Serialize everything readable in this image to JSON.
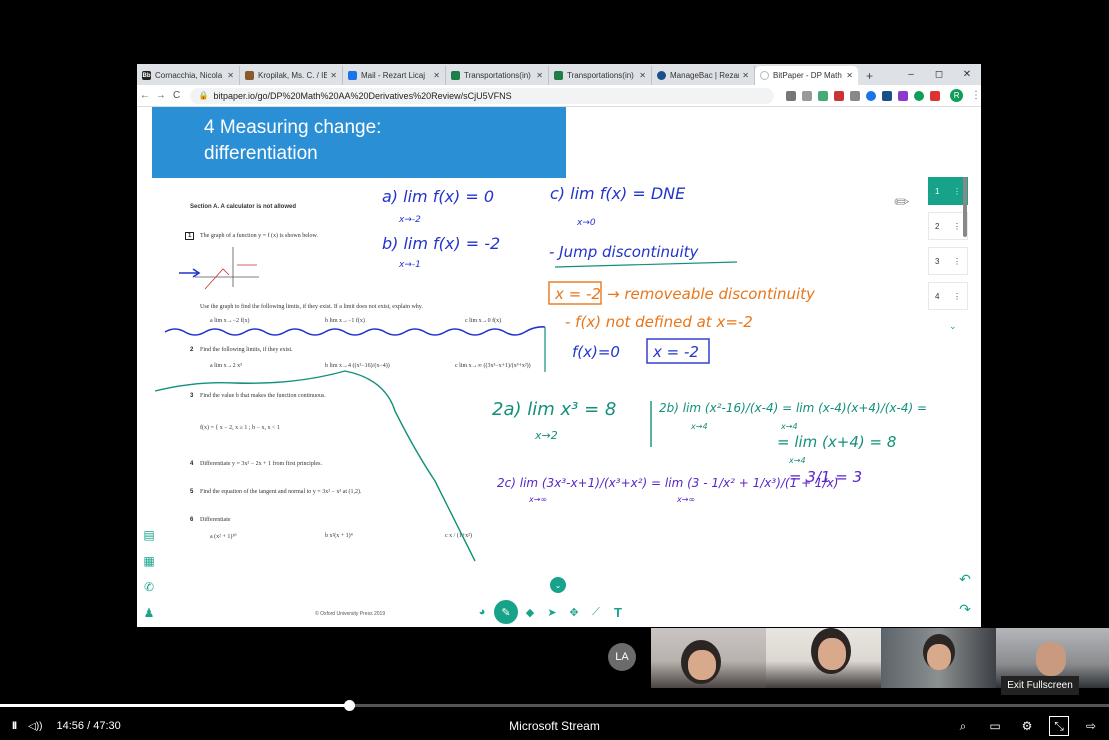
{
  "browser": {
    "tabs": [
      {
        "favicon": "Bb",
        "favicon_color": "#222",
        "label": "Cornacchia, Nicola"
      },
      {
        "favicon": "",
        "favicon_color": "#8a5a2b",
        "label": "Kropilak, Ms. C. / IB"
      },
      {
        "favicon": "",
        "favicon_color": "#1a73e8",
        "label": "Mail - Rezart Licaj"
      },
      {
        "favicon": "",
        "favicon_color": "#1e7e45",
        "label": "Transportations(in)"
      },
      {
        "favicon": "",
        "favicon_color": "#1e7e45",
        "label": "Transportations(in)"
      },
      {
        "favicon": "",
        "favicon_color": "#1a4f8a",
        "label": "ManageBac | Rezart"
      },
      {
        "favicon": "",
        "favicon_color": "#bbbbbb",
        "label": "BitPaper - DP Math"
      }
    ],
    "new_tab": "+",
    "window_controls": [
      "–",
      "◻",
      "✕"
    ],
    "url": "bitpaper.io/go/DP%20Math%20AA%20Derivatives%20Review/sCjU5VFNS",
    "profile_initial": "R"
  },
  "document": {
    "banner_title_line1": "4 Measuring change:",
    "banner_title_line2": "differentiation",
    "section_heading": "Section A. A calculator is not allowed",
    "q1": "The graph of a function y = f (x) is shown below.",
    "q1_instruction": "Use the graph to find the following limits, if they exist. If a limit does not exist, explain why.",
    "q1_a": "a  lim x→−2 f(x)",
    "q1_b": "b  lim x→−1 f(x)",
    "q1_c": "c  lim x→0 f(x)",
    "q2": "Find the following limits, if they exist.",
    "q2_a": "a  lim x→2 x³",
    "q2_b": "b  lim x→4 ((x²−16)/(x−4))",
    "q2_c": "c  lim x→∞ ((3x³−x+1)/(x³+x²))",
    "q3": "Find the value b that makes the function continuous.",
    "q3_f": "f(x) = { x − 2,  x ≥ 1 ;  b − x,  x < 1",
    "q4": "Differentiate y = 3x² − 2x + 1 from first principles.",
    "q5": "Find the equation of the tangent and normal to y = 3x² − x³ at (1,2).",
    "q6": "Differentiate",
    "q6_a": "a  (x² + 1)¹⁰",
    "q6_b": "b  x²(x + 1)⁴",
    "q6_c": "c  x / (1+x²)",
    "qnums": [
      "1",
      "2",
      "3",
      "4",
      "5",
      "6"
    ],
    "footer": "© Oxford University Press 2019",
    "page_badge": "1"
  },
  "handwriting": {
    "a_line1": "a) lim f(x) = 0",
    "a_line2": "x→-2",
    "b_line1": "b) lim f(x) = -2",
    "b_line2": "x→-1",
    "c_line1": "c) lim f(x) = DNE",
    "c_line2": "x→0",
    "jump": "- Jump discontinuity",
    "removable_box": "x = -2",
    "removable_text": "→ removeable discontinuity",
    "not_defined": "- f(x) not defined at x=-2",
    "fx0": "f(x)=0",
    "fx0_box": "x = -2",
    "two_a_1": "2a) lim x³ = 8",
    "two_a_2": "x→2",
    "two_b_1": "2b) lim (x²-16)/(x-4) = lim (x-4)(x+4)/(x-4) =",
    "two_b_2": "x→4",
    "two_b_3": "x→4",
    "two_b_4": "= lim (x+4) = 8",
    "two_b_5": "x→4",
    "two_c_1": "2c) lim (3x³-x+1)/(x³+x²) = lim (3 - 1/x² + 1/x³)/(1 + 1/x)",
    "two_c_2": "x→∞",
    "two_c_3": "x→∞",
    "two_c_4": "= 3/1 = 3",
    "colors": {
      "blue": "#2233cc",
      "teal": "#12907a",
      "orange": "#e8761a",
      "purple": "#5a24c8"
    }
  },
  "pages_panel": [
    {
      "label": "1",
      "menu": "⋮"
    },
    {
      "label": "2",
      "menu": "⋮"
    },
    {
      "label": "3",
      "menu": "⋮"
    },
    {
      "label": "4",
      "menu": "⋮"
    }
  ],
  "participants": {
    "avatar_initials": "LA"
  },
  "player": {
    "current_time": "14:56",
    "duration": "47:30",
    "time_separator": "/",
    "title": "Microsoft Stream",
    "progress_fraction": 0.3144,
    "tooltip": "Exit Fullscreen",
    "play_icon": "II",
    "volume_icon": "◁))"
  }
}
